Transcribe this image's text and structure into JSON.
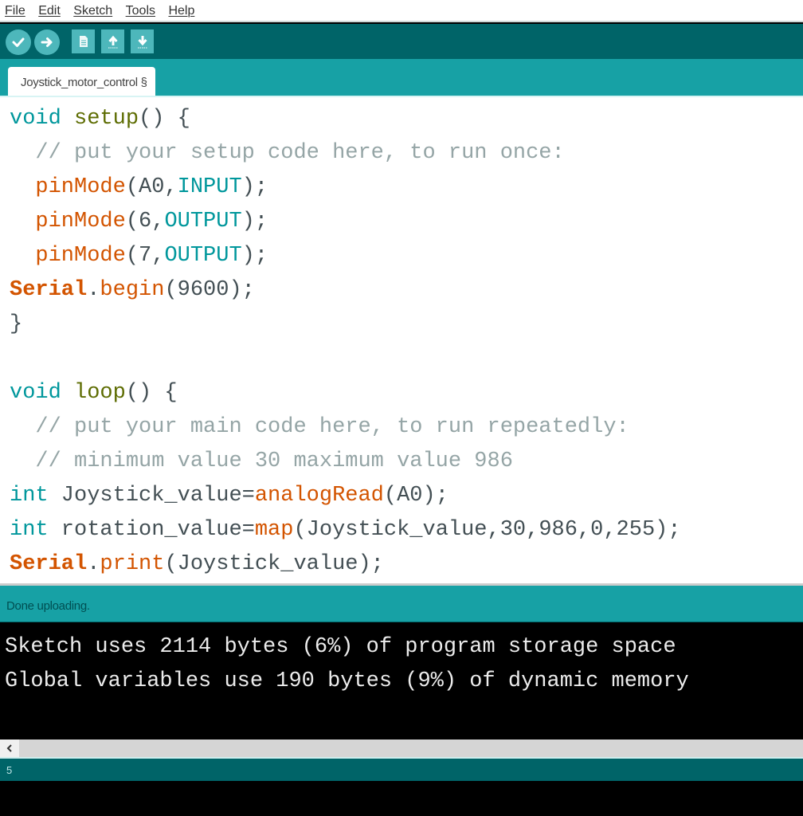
{
  "menu": {
    "items": [
      {
        "label": "File"
      },
      {
        "label": "Edit"
      },
      {
        "label": "Sketch"
      },
      {
        "label": "Tools"
      },
      {
        "label": "Help"
      }
    ]
  },
  "toolbar": {
    "buttons": [
      {
        "name": "verify",
        "icon": "check-icon"
      },
      {
        "name": "upload",
        "icon": "arrow-right-icon"
      },
      {
        "name": "new",
        "icon": "document-icon"
      },
      {
        "name": "open",
        "icon": "arrow-up-icon"
      },
      {
        "name": "save",
        "icon": "arrow-down-icon"
      }
    ]
  },
  "tab": {
    "label": "Joystick_motor_control §"
  },
  "editor": {
    "lines": [
      [
        {
          "t": "void",
          "c": "kw-type"
        },
        {
          "t": " ",
          "c": "plain"
        },
        {
          "t": "setup",
          "c": "kw-fn"
        },
        {
          "t": "() {",
          "c": "plain"
        }
      ],
      [
        {
          "t": "  // put your setup code here, to run once:",
          "c": "comment"
        }
      ],
      [
        {
          "t": "  ",
          "c": "plain"
        },
        {
          "t": "pinMode",
          "c": "kw-arduino"
        },
        {
          "t": "(A0,",
          "c": "plain"
        },
        {
          "t": "INPUT",
          "c": "kw-const"
        },
        {
          "t": ");",
          "c": "plain"
        }
      ],
      [
        {
          "t": "  ",
          "c": "plain"
        },
        {
          "t": "pinMode",
          "c": "kw-arduino"
        },
        {
          "t": "(6,",
          "c": "plain"
        },
        {
          "t": "OUTPUT",
          "c": "kw-const"
        },
        {
          "t": ");",
          "c": "plain"
        }
      ],
      [
        {
          "t": "  ",
          "c": "plain"
        },
        {
          "t": "pinMode",
          "c": "kw-arduino"
        },
        {
          "t": "(7,",
          "c": "plain"
        },
        {
          "t": "OUTPUT",
          "c": "kw-const"
        },
        {
          "t": ");",
          "c": "plain"
        }
      ],
      [
        {
          "t": "Serial",
          "c": "kw-serial"
        },
        {
          "t": ".",
          "c": "plain"
        },
        {
          "t": "begin",
          "c": "kw-arduino"
        },
        {
          "t": "(9600);",
          "c": "plain"
        }
      ],
      [
        {
          "t": "}",
          "c": "plain"
        }
      ],
      [
        {
          "t": "",
          "c": "plain"
        }
      ],
      [
        {
          "t": "void",
          "c": "kw-type"
        },
        {
          "t": " ",
          "c": "plain"
        },
        {
          "t": "loop",
          "c": "kw-fn"
        },
        {
          "t": "() {",
          "c": "plain"
        }
      ],
      [
        {
          "t": "  // put your main code here, to run repeatedly:",
          "c": "comment"
        }
      ],
      [
        {
          "t": "  // minimum value 30 maximum value 986",
          "c": "comment"
        }
      ],
      [
        {
          "t": "int",
          "c": "kw-type"
        },
        {
          "t": " Joystick_value=",
          "c": "plain"
        },
        {
          "t": "analogRead",
          "c": "kw-arduino"
        },
        {
          "t": "(A0);",
          "c": "plain"
        }
      ],
      [
        {
          "t": "int",
          "c": "kw-type"
        },
        {
          "t": " rotation_value=",
          "c": "plain"
        },
        {
          "t": "map",
          "c": "kw-arduino"
        },
        {
          "t": "(Joystick_value,30,986,0,255);",
          "c": "plain"
        }
      ],
      [
        {
          "t": "Serial",
          "c": "kw-serial"
        },
        {
          "t": ".",
          "c": "plain"
        },
        {
          "t": "print",
          "c": "kw-arduino"
        },
        {
          "t": "(Joystick_value);",
          "c": "plain"
        }
      ]
    ]
  },
  "status": {
    "message": "Done uploading."
  },
  "console": {
    "lines": [
      "Sketch uses 2114 bytes (6%) of program storage space",
      "Global variables use 190 bytes (9%) of dynamic memory"
    ]
  },
  "footer": {
    "line_number": "5"
  },
  "colors": {
    "toolbar_bg": "#006468",
    "tabbar_bg": "#17a1a5",
    "button_bg": "#4db7bb",
    "keyword_type": "#00979c",
    "keyword_arduino": "#d35400",
    "function_name": "#5e6d03",
    "comment": "#95a5a6"
  }
}
